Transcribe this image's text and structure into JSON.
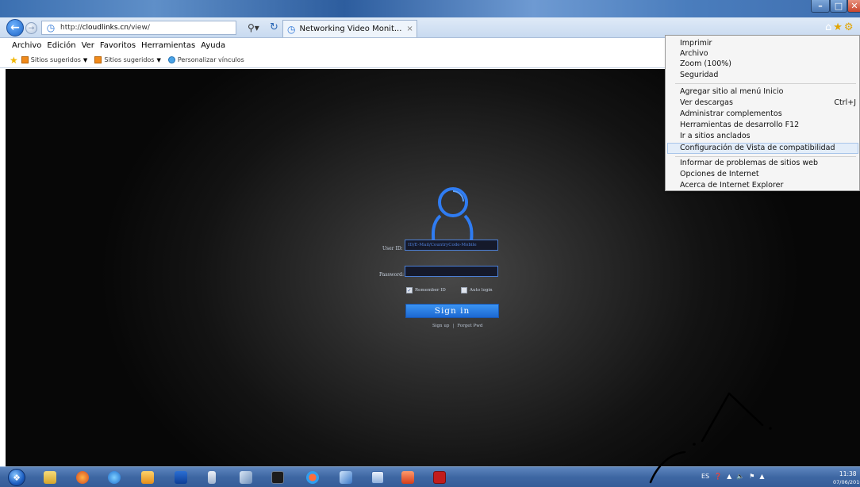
{
  "browser": {
    "address": {
      "prefix": "http://",
      "domain": "cloudlinks.cn",
      "path": "/view/"
    },
    "tab": {
      "title": "Networking Video Monit...",
      "close": "×"
    },
    "search_icon": "search-icon",
    "refresh_icon": "refresh-icon"
  },
  "menubar": [
    "Archivo",
    "Edición",
    "Ver",
    "Favoritos",
    "Herramientas",
    "Ayuda"
  ],
  "favbar": {
    "items": [
      {
        "label": "Sitios sugeridos"
      },
      {
        "label": "Sitios sugeridos"
      },
      {
        "label": "Personalizar vínculos"
      }
    ]
  },
  "login": {
    "user_label": "User ID:",
    "user_placeholder": "ID/E-Mail/CountryCode-Mobile",
    "password_label": "Password:",
    "remember": "Remember ID",
    "auto_login": "Auto login",
    "signin": "Sign in",
    "signup": "Sign up",
    "divider": "|",
    "forgot": "Forget Pwd",
    "accent_color": "#1c68d2"
  },
  "tools_menu": {
    "items": [
      {
        "label": "Imprimir"
      },
      {
        "label": "Archivo"
      },
      {
        "label": "Zoom (100%)"
      },
      {
        "label": "Seguridad"
      },
      {
        "label": "Agregar sitio al menú Inicio"
      },
      {
        "label": "Ver descargas",
        "shortcut": "Ctrl+J"
      },
      {
        "label": "Administrar complementos"
      },
      {
        "label": "Herramientas de desarrollo F12"
      },
      {
        "label": "Ir a sitios anclados"
      },
      {
        "label": "Configuración de Vista de compatibilidad",
        "highlighted": true
      },
      {
        "label": "Informar de problemas de sitios web"
      },
      {
        "label": "Opciones de Internet"
      },
      {
        "label": "Acerca de Internet Explorer"
      }
    ]
  },
  "taskbar": {
    "language": "ES",
    "time": "11:38",
    "date": "07/06/2016"
  }
}
